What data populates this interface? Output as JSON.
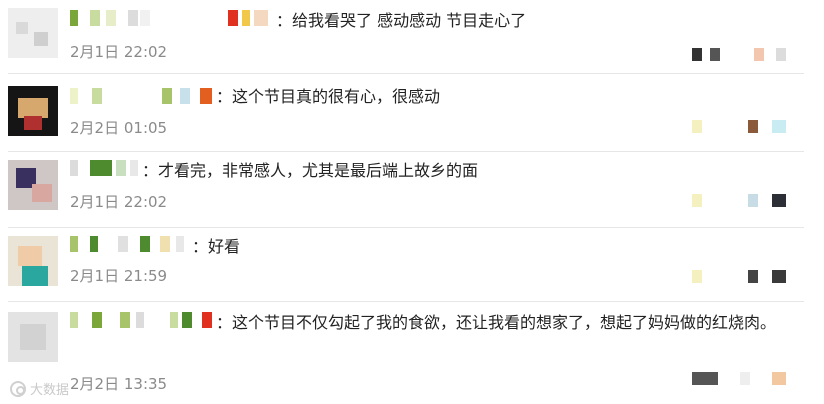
{
  "comments": [
    {
      "text": "：给我看哭了 感动感动 节目走心了",
      "time": "2月1日 22:02"
    },
    {
      "text": "：这个节目真的很有心，很感动",
      "time": "2月2日 01:05"
    },
    {
      "text": "：才看完，非常感人，尤其是最后端上故乡的面",
      "time": "2月1日 22:02"
    },
    {
      "text": "：好看",
      "time": "2月1日 21:59"
    },
    {
      "text": "：这个节目不仅勾起了我的食欲，还让我看的想家了，想起了妈妈做的红烧肉。",
      "time": "2月2日 13:35"
    }
  ],
  "watermark": {
    "text": "大数据"
  },
  "colors": {
    "text": "#222222",
    "time": "#8a8a8a",
    "divider": "#e6e6e6"
  }
}
